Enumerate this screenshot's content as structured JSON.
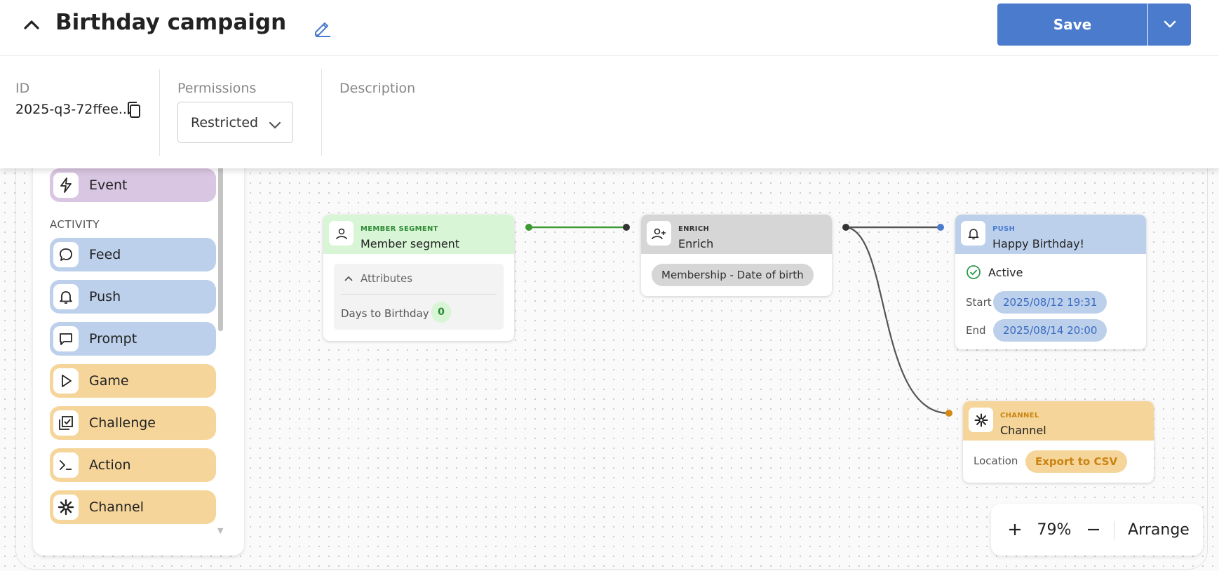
{
  "header": {
    "title": "Birthday campaign",
    "save_label": "Save"
  },
  "meta": {
    "id_label": "ID",
    "id_value": "2025-q3-72ffee...",
    "permissions_label": "Permissions",
    "permissions_value": "Restricted",
    "description_label": "Description"
  },
  "palette": {
    "top_item": {
      "label": "Event",
      "icon": "lightning-icon",
      "color": "#d9c6e2"
    },
    "section_label": "ACTIVITY",
    "items": [
      {
        "label": "Feed",
        "icon": "chat-bubble-icon",
        "color": "#bcd0ec"
      },
      {
        "label": "Push",
        "icon": "bell-icon",
        "color": "#bcd0ec"
      },
      {
        "label": "Prompt",
        "icon": "message-square-icon",
        "color": "#bcd0ec"
      },
      {
        "label": "Game",
        "icon": "play-icon",
        "color": "#f5d59a"
      },
      {
        "label": "Challenge",
        "icon": "checklist-icon",
        "color": "#f5d59a"
      },
      {
        "label": "Action",
        "icon": "terminal-icon",
        "color": "#f5d59a"
      },
      {
        "label": "Channel",
        "icon": "asterisk-icon",
        "color": "#f5d59a"
      }
    ]
  },
  "nodes": {
    "segment": {
      "type": "MEMBER SEGMENT",
      "name": "Member segment",
      "attributes_label": "Attributes",
      "attr_name": "Days to Birthday",
      "attr_value": "0"
    },
    "enrich": {
      "type": "ENRICH",
      "name": "Enrich",
      "chip": "Membership - Date of birth"
    },
    "push": {
      "type": "PUSH",
      "name": "Happy Birthday!",
      "status": "Active",
      "start_label": "Start",
      "start_value": "2025/08/12 19:31",
      "end_label": "End",
      "end_value": "2025/08/14 20:00"
    },
    "channel": {
      "type": "CHANNEL",
      "name": "Channel",
      "location_label": "Location",
      "location_value": "Export to CSV"
    }
  },
  "zoom": {
    "level": "79%",
    "arrange_label": "Arrange"
  },
  "colors": {
    "accent": "#4a7bcd",
    "segment": "#d8f5d6",
    "enrich": "#d6d6d6",
    "push": "#bcd0ec",
    "channel": "#f5d59a",
    "active": "#2e9a4a"
  }
}
